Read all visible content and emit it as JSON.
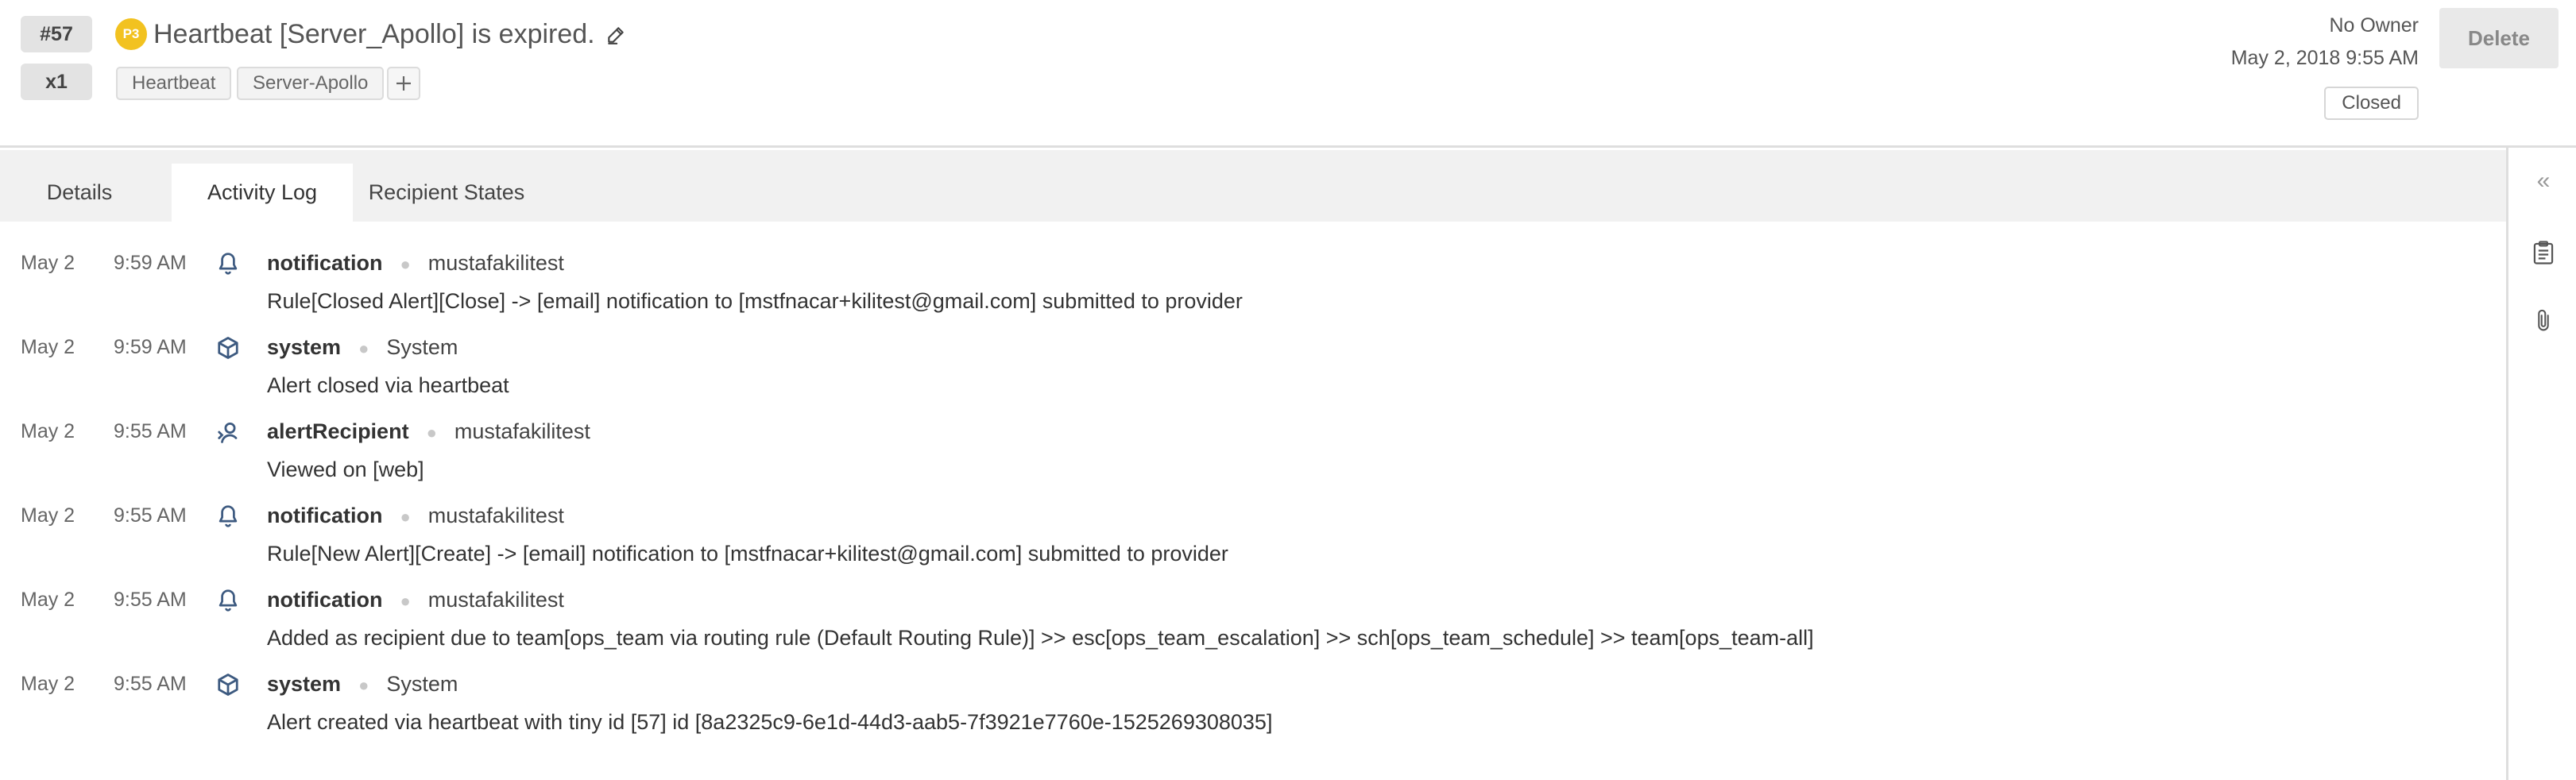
{
  "alert": {
    "number": "#57",
    "count": "x1",
    "priority": "P3",
    "title": "Heartbeat [Server_Apollo] is expired.",
    "tags": [
      "Heartbeat",
      "Server-Apollo"
    ],
    "owner": "No Owner",
    "created": "May 2, 2018 9:55 AM",
    "status": "Closed",
    "delete_label": "Delete"
  },
  "colors": {
    "priority": "#f2c220",
    "icon": "#3d5a80",
    "tab_bar": "#f1f1f1"
  },
  "tabs": [
    {
      "label": "Details",
      "active": false
    },
    {
      "label": "Activity Log",
      "active": true
    },
    {
      "label": "Recipient States",
      "active": false
    }
  ],
  "rail": {
    "collapse_glyph": "«"
  },
  "log": [
    {
      "date": "May 2",
      "time": "9:59 AM",
      "icon": "bell-icon",
      "type": "notification",
      "user": "mustafakilitest",
      "message": "Rule[Closed Alert][Close] -> [email] notification to [mstfnacar+kilitest@gmail.com] submitted to provider"
    },
    {
      "date": "May 2",
      "time": "9:59 AM",
      "icon": "cube-icon",
      "type": "system",
      "user": "System",
      "message": "Alert closed via heartbeat"
    },
    {
      "date": "May 2",
      "time": "9:55 AM",
      "icon": "user-recipient-icon",
      "type": "alertRecipient",
      "user": "mustafakilitest",
      "message": "Viewed on [web]"
    },
    {
      "date": "May 2",
      "time": "9:55 AM",
      "icon": "bell-icon",
      "type": "notification",
      "user": "mustafakilitest",
      "message": "Rule[New Alert][Create] -> [email] notification to [mstfnacar+kilitest@gmail.com] submitted to provider"
    },
    {
      "date": "May 2",
      "time": "9:55 AM",
      "icon": "bell-icon",
      "type": "notification",
      "user": "mustafakilitest",
      "message": "Added as recipient due to team[ops_team via routing rule (Default Routing Rule)] >> esc[ops_team_escalation] >> sch[ops_team_schedule] >> team[ops_team-all]"
    },
    {
      "date": "May 2",
      "time": "9:55 AM",
      "icon": "cube-icon",
      "type": "system",
      "user": "System",
      "message": "Alert created via heartbeat with tiny id [57] id [8a2325c9-6e1d-44d3-aab5-7f3921e7760e-1525269308035]"
    }
  ]
}
